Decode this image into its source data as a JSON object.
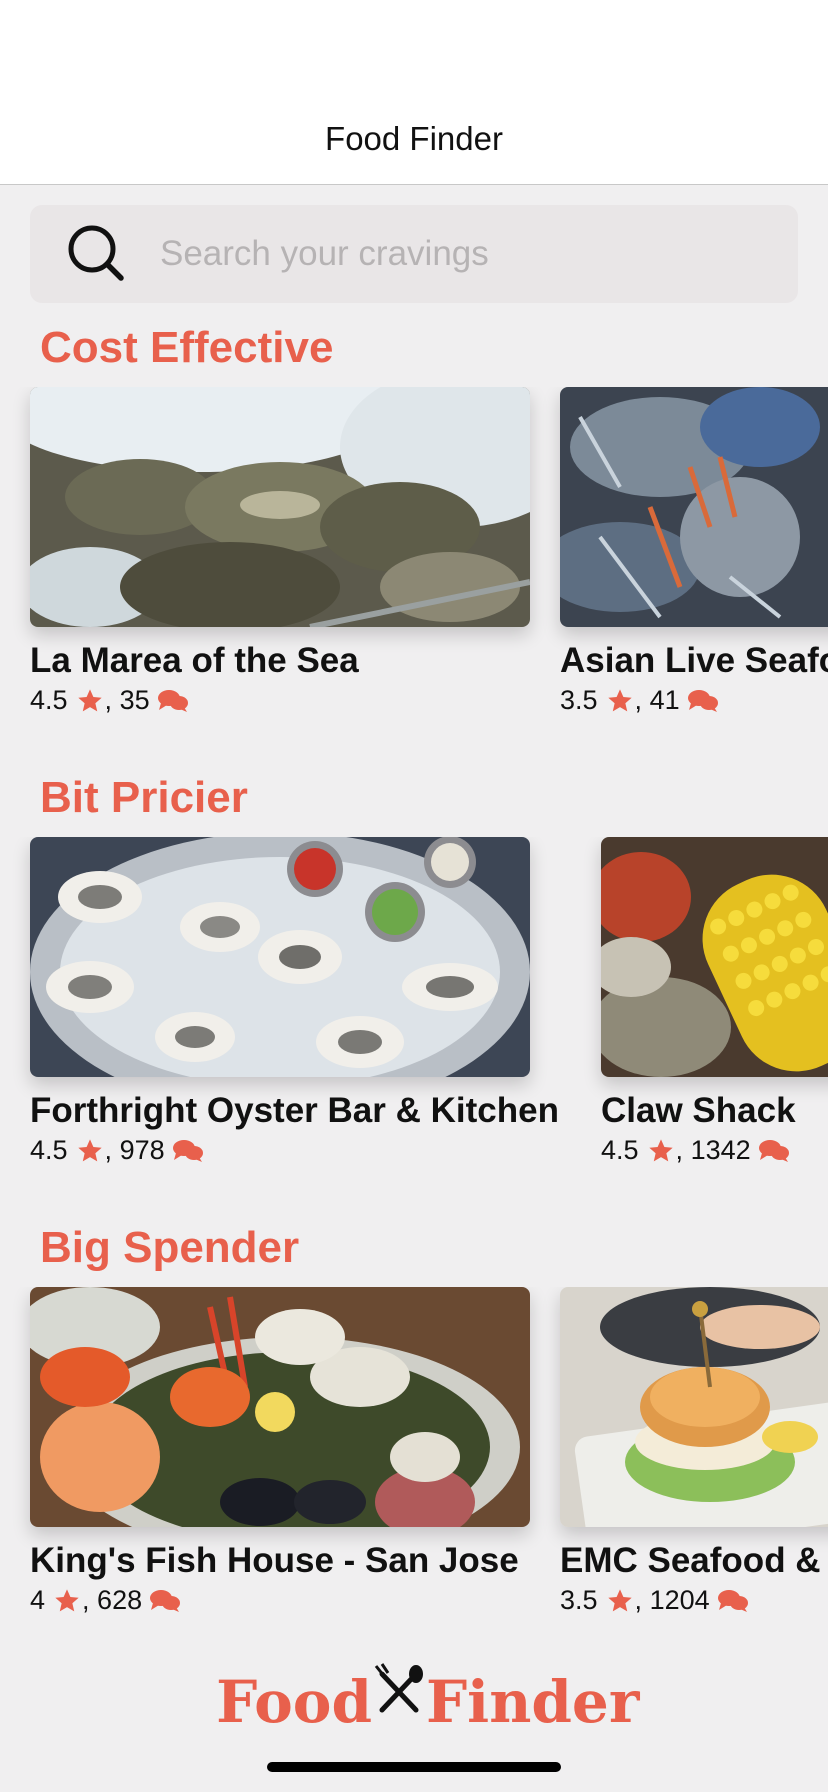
{
  "app": {
    "title": "Food Finder",
    "accent_color": "#e8604c"
  },
  "search": {
    "placeholder": "Search your cravings",
    "value": "",
    "icon": "search-icon"
  },
  "sections": [
    {
      "title": "Cost Effective",
      "cards": [
        {
          "name": "La Marea of the Sea",
          "rating": "4.5",
          "reviews": "35",
          "image": "oysters on ice"
        },
        {
          "name": "Asian Live Seafood",
          "rating": "3.5",
          "reviews": "41",
          "image": "blue crabs"
        }
      ]
    },
    {
      "title": "Bit Pricier",
      "cards": [
        {
          "name": "Forthright Oyster Bar & Kitchen",
          "rating": "4.5",
          "reviews": "978",
          "image": "oyster platter with sauces"
        },
        {
          "name": "Claw Shack",
          "rating": "4.5",
          "reviews": "1342",
          "image": "corn and crawfish boil"
        }
      ]
    },
    {
      "title": "Big Spender",
      "cards": [
        {
          "name": "King's Fish House - San Jose",
          "rating": "4",
          "reviews": "628",
          "image": "seafood tower"
        },
        {
          "name": "EMC Seafood &",
          "rating": "3.5",
          "reviews": "1204",
          "image": "seafood slider"
        }
      ]
    }
  ],
  "icons": {
    "rating": "star-icon",
    "reviews": "comments-icon"
  },
  "footer": {
    "logo_left": "Food",
    "logo_right": "Finder",
    "logo_icon": "fork-spoon-icon"
  }
}
